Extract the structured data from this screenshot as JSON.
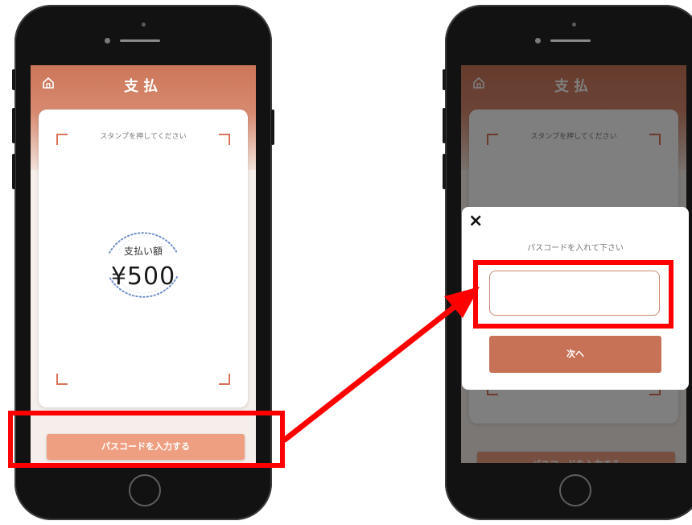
{
  "screen": {
    "title": "支払",
    "stamp_prompt": "スタンプを押してください",
    "amount_label": "支払い額",
    "amount_value": "¥500",
    "passcode_button": "パスコードを入力する"
  },
  "modal": {
    "close_icon": "×",
    "prompt": "パスコードを入れて下さい",
    "input_value": "",
    "next_button": "次へ"
  },
  "colors": {
    "header": "#cc7659",
    "accent_button": "#ee9f82",
    "next_button": "#c77257",
    "highlight": "#ff0000"
  },
  "icons": [
    "home-icon",
    "close-icon",
    "dotted-circle-icon"
  ]
}
